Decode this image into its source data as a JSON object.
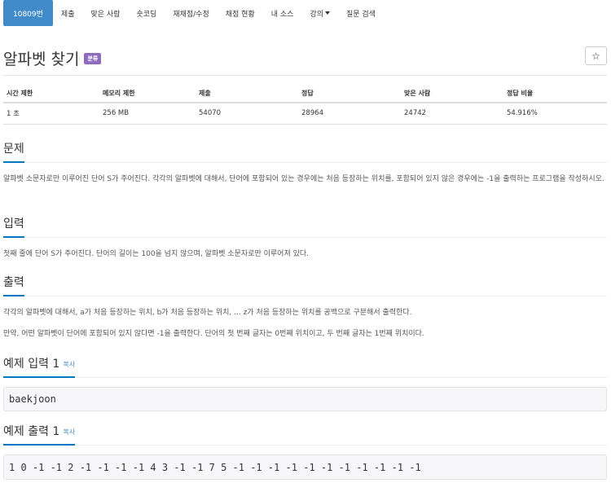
{
  "nav": {
    "items": [
      "10809번",
      "제출",
      "맞은 사람",
      "숏코딩",
      "재채점/수정",
      "채점 현황",
      "내 소스",
      "강의",
      "질문 검색"
    ]
  },
  "problem": {
    "title": "알파벳 찾기",
    "badge": "분류",
    "star": "☆"
  },
  "info_table": {
    "headers": [
      "시간 제한",
      "메모리 제한",
      "제출",
      "정답",
      "맞은 사람",
      "정답 비율"
    ],
    "values": [
      "1 초",
      "256 MB",
      "54070",
      "28964",
      "24742",
      "54.916%"
    ]
  },
  "sections": {
    "problem": {
      "title": "문제",
      "text": "알파벳 소문자로만 이루어진 단어 S가 주어진다. 각각의 알파벳에 대해서, 단어에 포함되어 있는 경우에는 처음 등장하는 위치를, 포함되어 있지 않은 경우에는 -1을 출력하는 프로그램을 작성하시오."
    },
    "input": {
      "title": "입력",
      "text": "첫째 줄에 단어 S가 주어진다. 단어의 길이는 100을 넘지 않으며, 알파벳 소문자로만 이루어져 있다."
    },
    "output": {
      "title": "출력",
      "text1": "각각의 알파벳에 대해서, a가 처음 등장하는 위치, b가 처음 등장하는 위치, ... z가 처음 등장하는 위치를 공백으로 구분해서 출력한다.",
      "text2": "만약, 어떤 알파벳이 단어에 포함되어 있지 않다면 -1을 출력한다. 단어의 첫 번째 글자는 0번째 위치이고, 두 번째 글자는 1번째 위치이다."
    },
    "sample_input": {
      "title": "예제 입력 1",
      "copy": "복사",
      "content": "baekjoon"
    },
    "sample_output": {
      "title": "예제 출력 1",
      "copy": "복사",
      "content": "1 0 -1 -1 2 -1 -1 -1 -1 4 3 -1 -1 7 5 -1 -1 -1 -1 -1 -1 -1 -1 -1 -1 -1"
    }
  },
  "colors": {
    "nav_active": "#428bca",
    "badge": "#8e6bbf",
    "section_underline": "#0076c0",
    "link": "#428bca"
  }
}
